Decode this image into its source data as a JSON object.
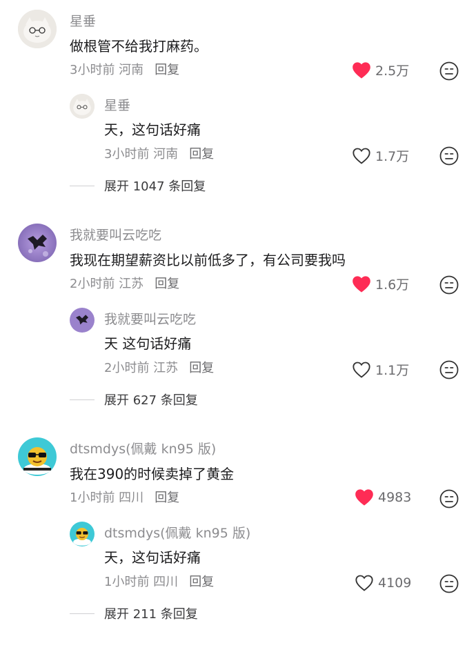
{
  "threads": [
    {
      "user": "星垂",
      "text": "做根管不给我打麻药。",
      "time_loc": "3小时前 河南",
      "reply_label": "回复",
      "likes": "2.5万",
      "liked": true,
      "reply": {
        "user": "星垂",
        "text": "天，这句话好痛",
        "time_loc": "3小时前 河南",
        "reply_label": "回复",
        "likes": "1.7万",
        "liked": false
      },
      "expand": "展开 1047 条回复"
    },
    {
      "user": "我就要叫云吃吃",
      "text": "我现在期望薪资比以前低多了，有公司要我吗",
      "time_loc": "2小时前 江苏",
      "reply_label": "回复",
      "likes": "1.6万",
      "liked": true,
      "reply": {
        "user": "我就要叫云吃吃",
        "text": "天 这句话好痛",
        "time_loc": "2小时前 江苏",
        "reply_label": "回复",
        "likes": "1.1万",
        "liked": false
      },
      "expand": "展开 627 条回复"
    },
    {
      "user": "dtsmdys(佩戴 kn95 版)",
      "text": "我在390的时候卖掉了黄金",
      "time_loc": "1小时前 四川",
      "reply_label": "回复",
      "likes": "4983",
      "liked": true,
      "reply": {
        "user": "dtsmdys(佩戴 kn95 版)",
        "text": "天，这句话好痛",
        "time_loc": "1小时前 四川",
        "reply_label": "回复",
        "likes": "4109",
        "liked": false
      },
      "expand": "展开 211 条回复"
    }
  ],
  "colors": {
    "like_red": "#fe2c55",
    "muted": "#8c8c8f",
    "text": "#1c1c1e"
  },
  "icons": {
    "like": "heart-icon",
    "dislike": "neutral-face-icon"
  }
}
